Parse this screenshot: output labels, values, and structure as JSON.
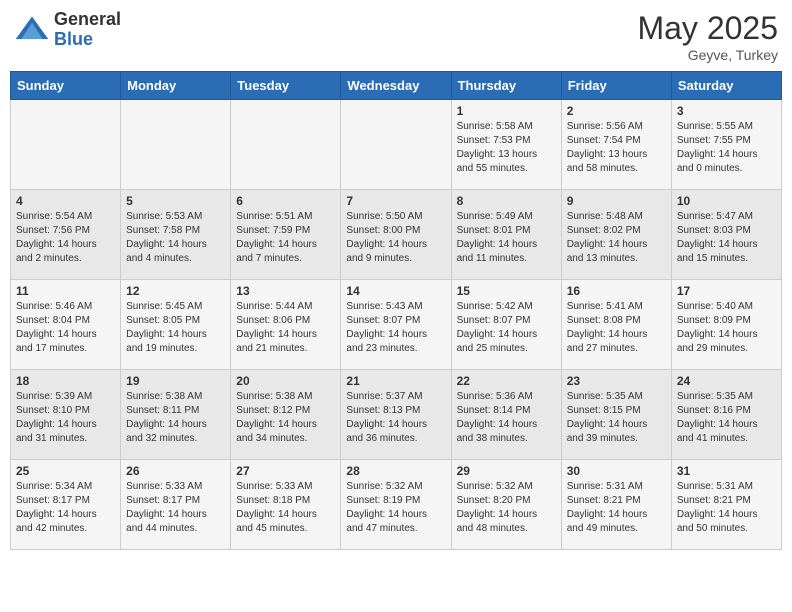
{
  "header": {
    "logo_general": "General",
    "logo_blue": "Blue",
    "month_year": "May 2025",
    "location": "Geyve, Turkey"
  },
  "days_of_week": [
    "Sunday",
    "Monday",
    "Tuesday",
    "Wednesday",
    "Thursday",
    "Friday",
    "Saturday"
  ],
  "weeks": [
    [
      {
        "day": "",
        "content": ""
      },
      {
        "day": "",
        "content": ""
      },
      {
        "day": "",
        "content": ""
      },
      {
        "day": "",
        "content": ""
      },
      {
        "day": "1",
        "content": "Sunrise: 5:58 AM\nSunset: 7:53 PM\nDaylight: 13 hours\nand 55 minutes."
      },
      {
        "day": "2",
        "content": "Sunrise: 5:56 AM\nSunset: 7:54 PM\nDaylight: 13 hours\nand 58 minutes."
      },
      {
        "day": "3",
        "content": "Sunrise: 5:55 AM\nSunset: 7:55 PM\nDaylight: 14 hours\nand 0 minutes."
      }
    ],
    [
      {
        "day": "4",
        "content": "Sunrise: 5:54 AM\nSunset: 7:56 PM\nDaylight: 14 hours\nand 2 minutes."
      },
      {
        "day": "5",
        "content": "Sunrise: 5:53 AM\nSunset: 7:58 PM\nDaylight: 14 hours\nand 4 minutes."
      },
      {
        "day": "6",
        "content": "Sunrise: 5:51 AM\nSunset: 7:59 PM\nDaylight: 14 hours\nand 7 minutes."
      },
      {
        "day": "7",
        "content": "Sunrise: 5:50 AM\nSunset: 8:00 PM\nDaylight: 14 hours\nand 9 minutes."
      },
      {
        "day": "8",
        "content": "Sunrise: 5:49 AM\nSunset: 8:01 PM\nDaylight: 14 hours\nand 11 minutes."
      },
      {
        "day": "9",
        "content": "Sunrise: 5:48 AM\nSunset: 8:02 PM\nDaylight: 14 hours\nand 13 minutes."
      },
      {
        "day": "10",
        "content": "Sunrise: 5:47 AM\nSunset: 8:03 PM\nDaylight: 14 hours\nand 15 minutes."
      }
    ],
    [
      {
        "day": "11",
        "content": "Sunrise: 5:46 AM\nSunset: 8:04 PM\nDaylight: 14 hours\nand 17 minutes."
      },
      {
        "day": "12",
        "content": "Sunrise: 5:45 AM\nSunset: 8:05 PM\nDaylight: 14 hours\nand 19 minutes."
      },
      {
        "day": "13",
        "content": "Sunrise: 5:44 AM\nSunset: 8:06 PM\nDaylight: 14 hours\nand 21 minutes."
      },
      {
        "day": "14",
        "content": "Sunrise: 5:43 AM\nSunset: 8:07 PM\nDaylight: 14 hours\nand 23 minutes."
      },
      {
        "day": "15",
        "content": "Sunrise: 5:42 AM\nSunset: 8:07 PM\nDaylight: 14 hours\nand 25 minutes."
      },
      {
        "day": "16",
        "content": "Sunrise: 5:41 AM\nSunset: 8:08 PM\nDaylight: 14 hours\nand 27 minutes."
      },
      {
        "day": "17",
        "content": "Sunrise: 5:40 AM\nSunset: 8:09 PM\nDaylight: 14 hours\nand 29 minutes."
      }
    ],
    [
      {
        "day": "18",
        "content": "Sunrise: 5:39 AM\nSunset: 8:10 PM\nDaylight: 14 hours\nand 31 minutes."
      },
      {
        "day": "19",
        "content": "Sunrise: 5:38 AM\nSunset: 8:11 PM\nDaylight: 14 hours\nand 32 minutes."
      },
      {
        "day": "20",
        "content": "Sunrise: 5:38 AM\nSunset: 8:12 PM\nDaylight: 14 hours\nand 34 minutes."
      },
      {
        "day": "21",
        "content": "Sunrise: 5:37 AM\nSunset: 8:13 PM\nDaylight: 14 hours\nand 36 minutes."
      },
      {
        "day": "22",
        "content": "Sunrise: 5:36 AM\nSunset: 8:14 PM\nDaylight: 14 hours\nand 38 minutes."
      },
      {
        "day": "23",
        "content": "Sunrise: 5:35 AM\nSunset: 8:15 PM\nDaylight: 14 hours\nand 39 minutes."
      },
      {
        "day": "24",
        "content": "Sunrise: 5:35 AM\nSunset: 8:16 PM\nDaylight: 14 hours\nand 41 minutes."
      }
    ],
    [
      {
        "day": "25",
        "content": "Sunrise: 5:34 AM\nSunset: 8:17 PM\nDaylight: 14 hours\nand 42 minutes."
      },
      {
        "day": "26",
        "content": "Sunrise: 5:33 AM\nSunset: 8:17 PM\nDaylight: 14 hours\nand 44 minutes."
      },
      {
        "day": "27",
        "content": "Sunrise: 5:33 AM\nSunset: 8:18 PM\nDaylight: 14 hours\nand 45 minutes."
      },
      {
        "day": "28",
        "content": "Sunrise: 5:32 AM\nSunset: 8:19 PM\nDaylight: 14 hours\nand 47 minutes."
      },
      {
        "day": "29",
        "content": "Sunrise: 5:32 AM\nSunset: 8:20 PM\nDaylight: 14 hours\nand 48 minutes."
      },
      {
        "day": "30",
        "content": "Sunrise: 5:31 AM\nSunset: 8:21 PM\nDaylight: 14 hours\nand 49 minutes."
      },
      {
        "day": "31",
        "content": "Sunrise: 5:31 AM\nSunset: 8:21 PM\nDaylight: 14 hours\nand 50 minutes."
      }
    ]
  ]
}
